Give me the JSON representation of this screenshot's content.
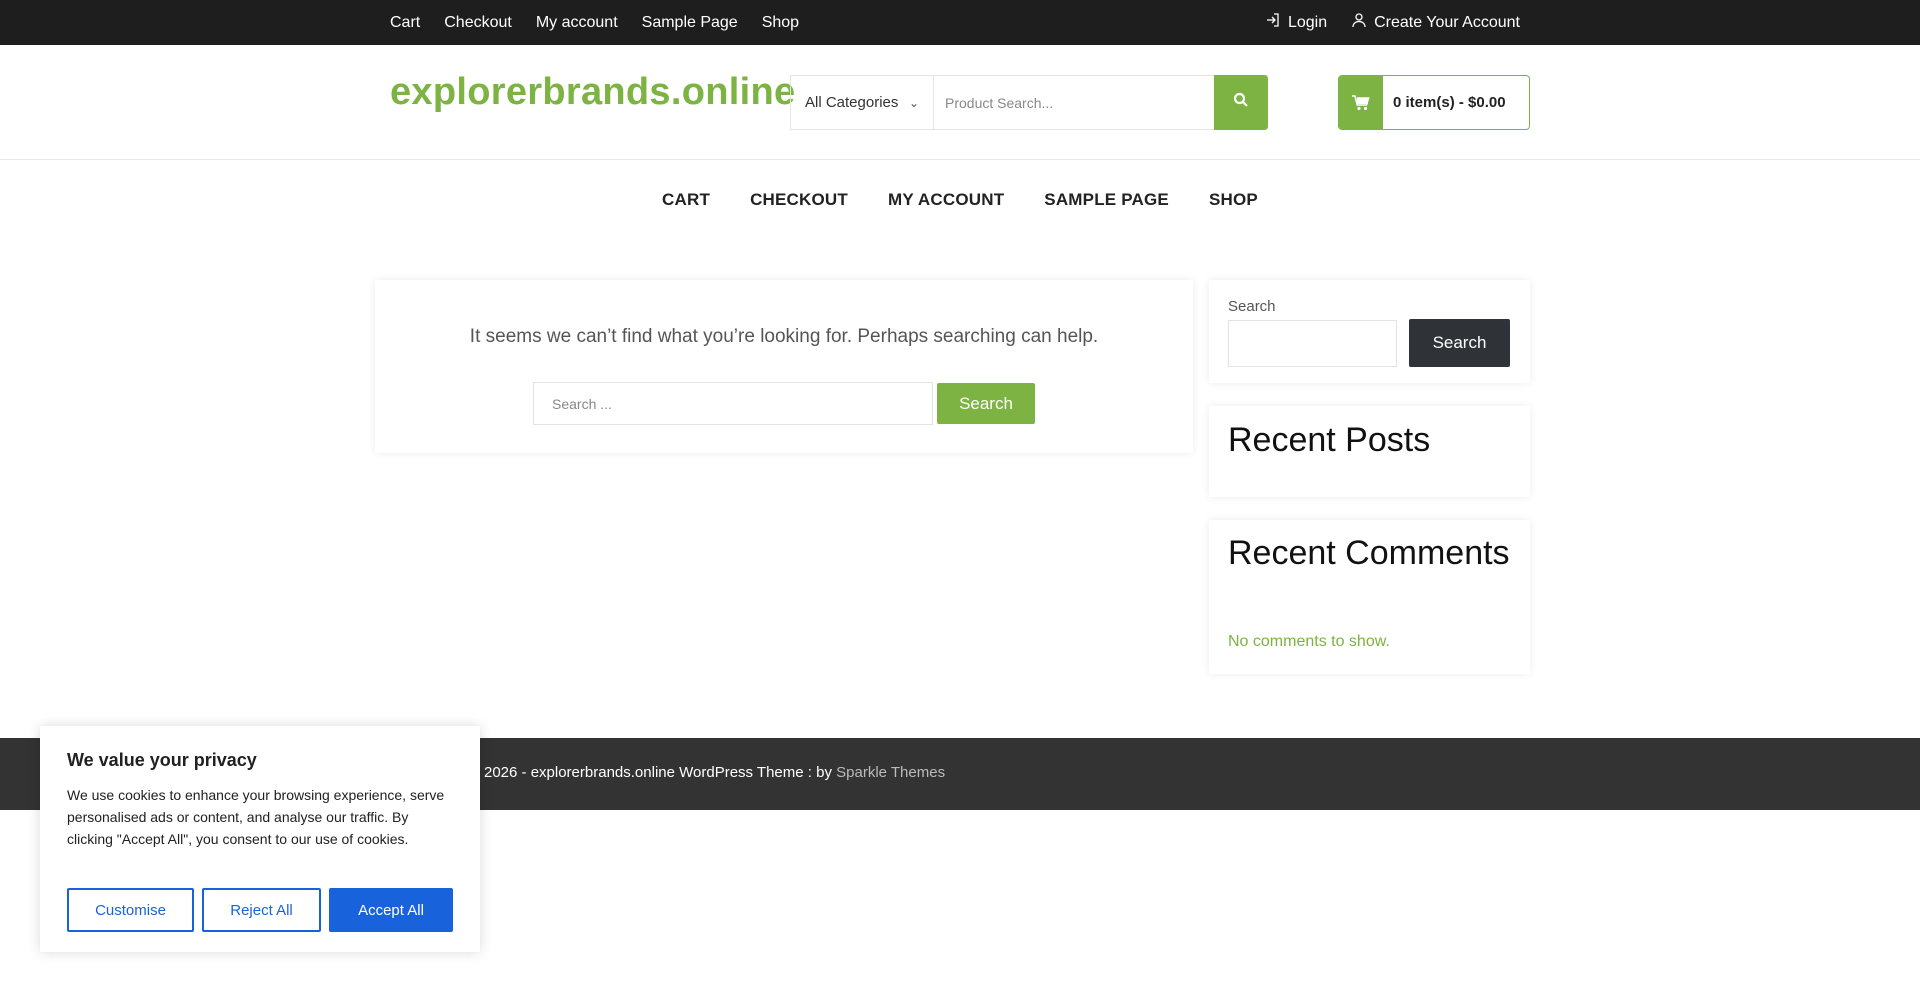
{
  "topbar": {
    "links": [
      "Cart",
      "Checkout",
      "My account",
      "Sample Page",
      "Shop"
    ],
    "login": "Login",
    "create_account": "Create Your Account"
  },
  "header": {
    "logo": "explorerbrands.online",
    "category": "All Categories",
    "search_placeholder": "Product Search...",
    "cart": "0 item(s) - $0.00"
  },
  "nav": [
    "CART",
    "CHECKOUT",
    "MY ACCOUNT",
    "SAMPLE PAGE",
    "SHOP"
  ],
  "main": {
    "message": "It seems we can’t find what you’re looking for. Perhaps searching can help.",
    "search_placeholder": "Search ...",
    "search_button": "Search"
  },
  "sidebar": {
    "search_label": "Search",
    "search_button": "Search",
    "recent_posts": "Recent Posts",
    "recent_comments": "Recent Comments",
    "no_comments": "No comments to show."
  },
  "footer": {
    "text": "2026 - explorerbrands.online WordPress Theme : by",
    "link": "Sparkle Themes"
  },
  "cookie": {
    "title": "We value your privacy",
    "body": "We use cookies to enhance your browsing experience, serve personalised ads or content, and analyse our traffic. By clicking \"Accept All\", you consent to our use of cookies.",
    "customise": "Customise",
    "reject": "Reject All",
    "accept": "Accept All"
  },
  "colors": {
    "accent": "#7cb342",
    "topbar": "#1e1e1e",
    "footer": "#333333",
    "cookie_blue": "#1863dc"
  }
}
